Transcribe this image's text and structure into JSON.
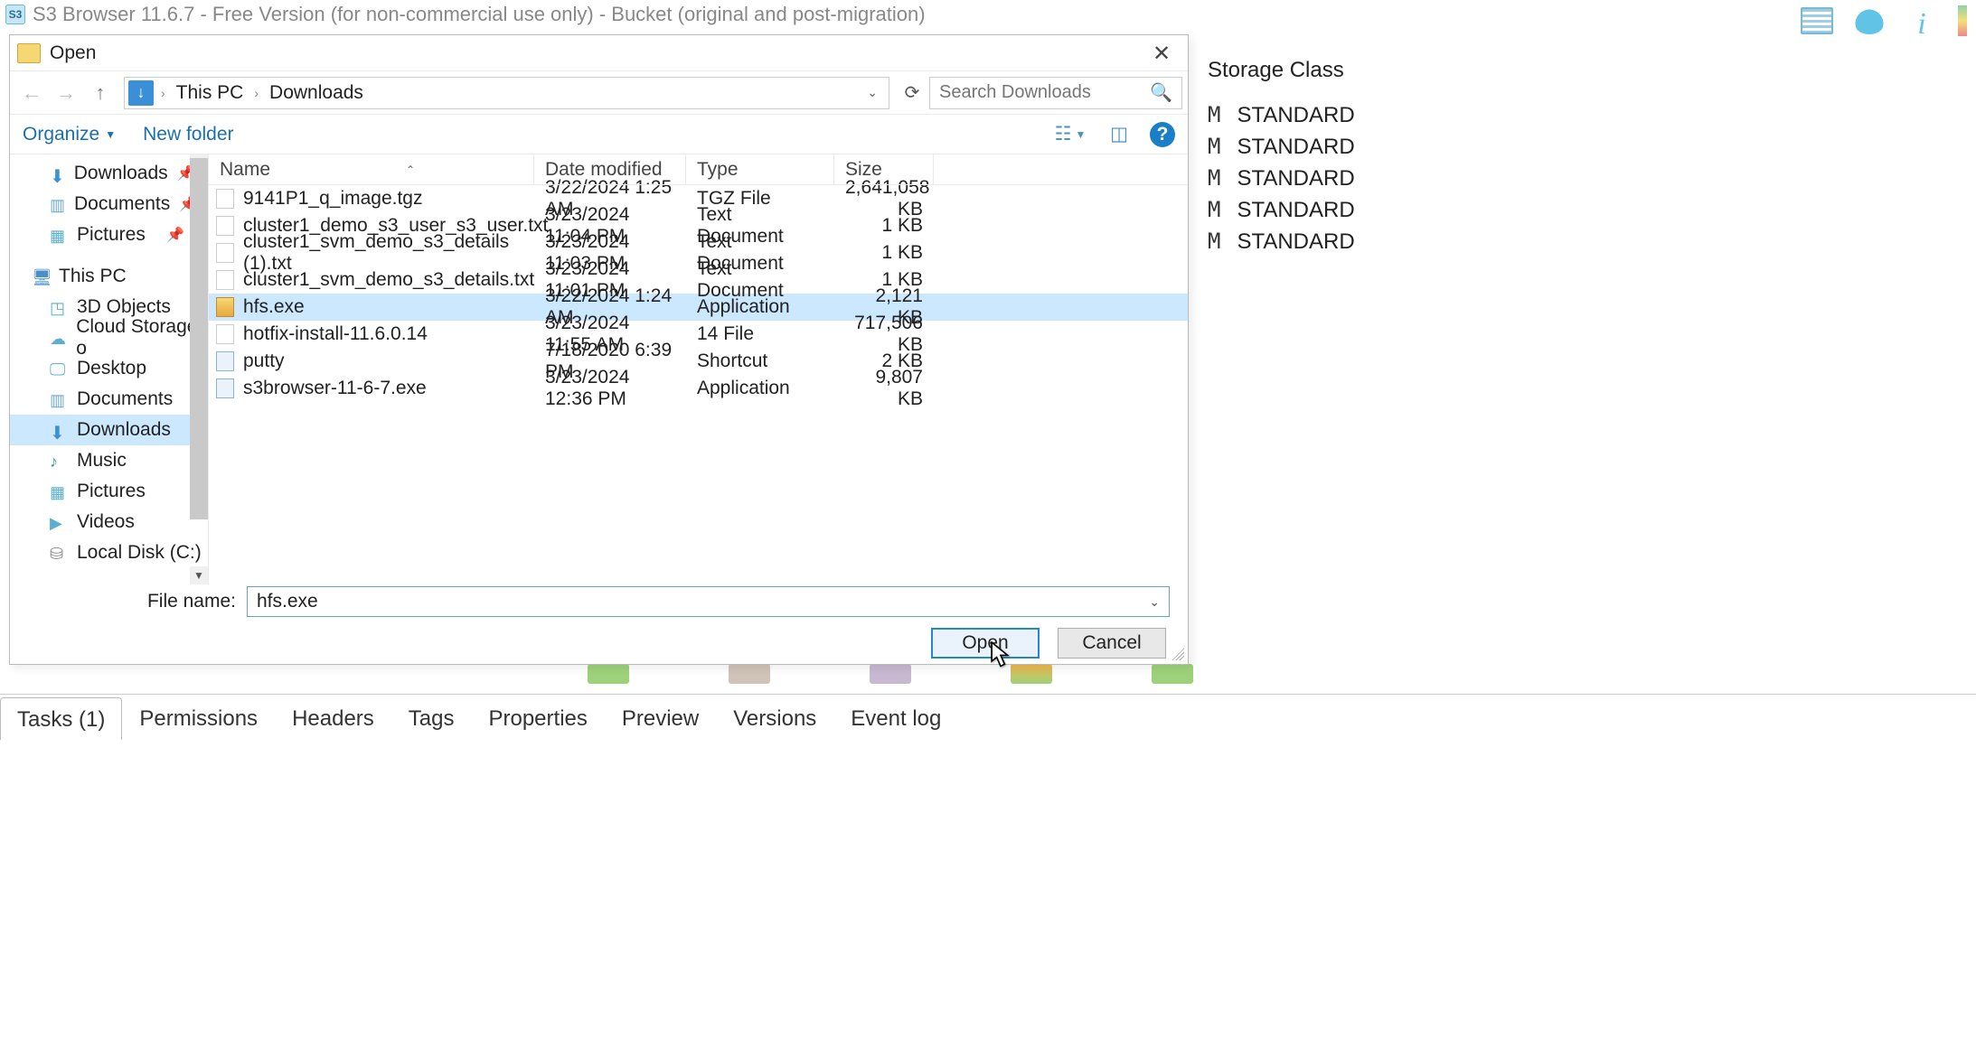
{
  "app": {
    "title": "S3 Browser 11.6.7 - Free Version (for non-commercial use only) - Bucket (original and post-migration)"
  },
  "bgPanel": {
    "header": "Storage Class",
    "rows": [
      "STANDARD",
      "STANDARD",
      "STANDARD",
      "STANDARD",
      "STANDARD"
    ]
  },
  "dialog": {
    "title": "Open",
    "breadcrumb": {
      "pc": "This PC",
      "folder": "Downloads"
    },
    "search": {
      "placeholder": "Search Downloads"
    },
    "toolbar": {
      "organize": "Organize",
      "newFolder": "New folder"
    },
    "sidebar": {
      "quick": [
        {
          "label": "Downloads",
          "pin": true,
          "icon": "dl"
        },
        {
          "label": "Documents",
          "pin": true,
          "icon": "doc"
        },
        {
          "label": "Pictures",
          "pin": true,
          "icon": "pic"
        }
      ],
      "pc": {
        "label": "This PC"
      },
      "pcItems": [
        {
          "label": "3D Objects",
          "icon": "3d"
        },
        {
          "label": "Cloud Storage o",
          "icon": "cloud"
        },
        {
          "label": "Desktop",
          "icon": "desk"
        },
        {
          "label": "Documents",
          "icon": "doc"
        },
        {
          "label": "Downloads",
          "icon": "dl",
          "selected": true
        },
        {
          "label": "Music",
          "icon": "mus"
        },
        {
          "label": "Pictures",
          "icon": "pic"
        },
        {
          "label": "Videos",
          "icon": "vid"
        },
        {
          "label": "Local Disk (C:)",
          "icon": "disk"
        }
      ]
    },
    "columns": {
      "name": "Name",
      "date": "Date modified",
      "type": "Type",
      "size": "Size"
    },
    "files": [
      {
        "name": "9141P1_q_image.tgz",
        "date": "3/22/2024 1:25 AM",
        "type": "TGZ File",
        "size": "2,641,058 KB",
        "ic": "file"
      },
      {
        "name": "cluster1_demo_s3_user_s3_user.txt",
        "date": "3/23/2024 11:04 PM",
        "type": "Text Document",
        "size": "1 KB",
        "ic": "file"
      },
      {
        "name": "cluster1_svm_demo_s3_details (1).txt",
        "date": "3/23/2024 11:03 PM",
        "type": "Text Document",
        "size": "1 KB",
        "ic": "file"
      },
      {
        "name": "cluster1_svm_demo_s3_details.txt",
        "date": "3/23/2024 11:01 PM",
        "type": "Text Document",
        "size": "1 KB",
        "ic": "file"
      },
      {
        "name": "hfs.exe",
        "date": "3/22/2024 1:24 AM",
        "type": "Application",
        "size": "2,121 KB",
        "ic": "hfs",
        "selected": true
      },
      {
        "name": "hotfix-install-11.6.0.14",
        "date": "3/23/2024 11:55 AM",
        "type": "14 File",
        "size": "717,506 KB",
        "ic": "file"
      },
      {
        "name": "putty",
        "date": "7/18/2020 6:39 PM",
        "type": "Shortcut",
        "size": "2 KB",
        "ic": "lnk"
      },
      {
        "name": "s3browser-11-6-7.exe",
        "date": "3/23/2024 12:36 PM",
        "type": "Application",
        "size": "9,807 KB",
        "ic": "exe"
      }
    ],
    "footer": {
      "fileNameLabel": "File name:",
      "fileName": "hfs.exe",
      "open": "Open",
      "cancel": "Cancel"
    }
  },
  "tabs": {
    "items": [
      "Tasks (1)",
      "Permissions",
      "Headers",
      "Tags",
      "Properties",
      "Preview",
      "Versions",
      "Event log"
    ],
    "active": 0
  }
}
